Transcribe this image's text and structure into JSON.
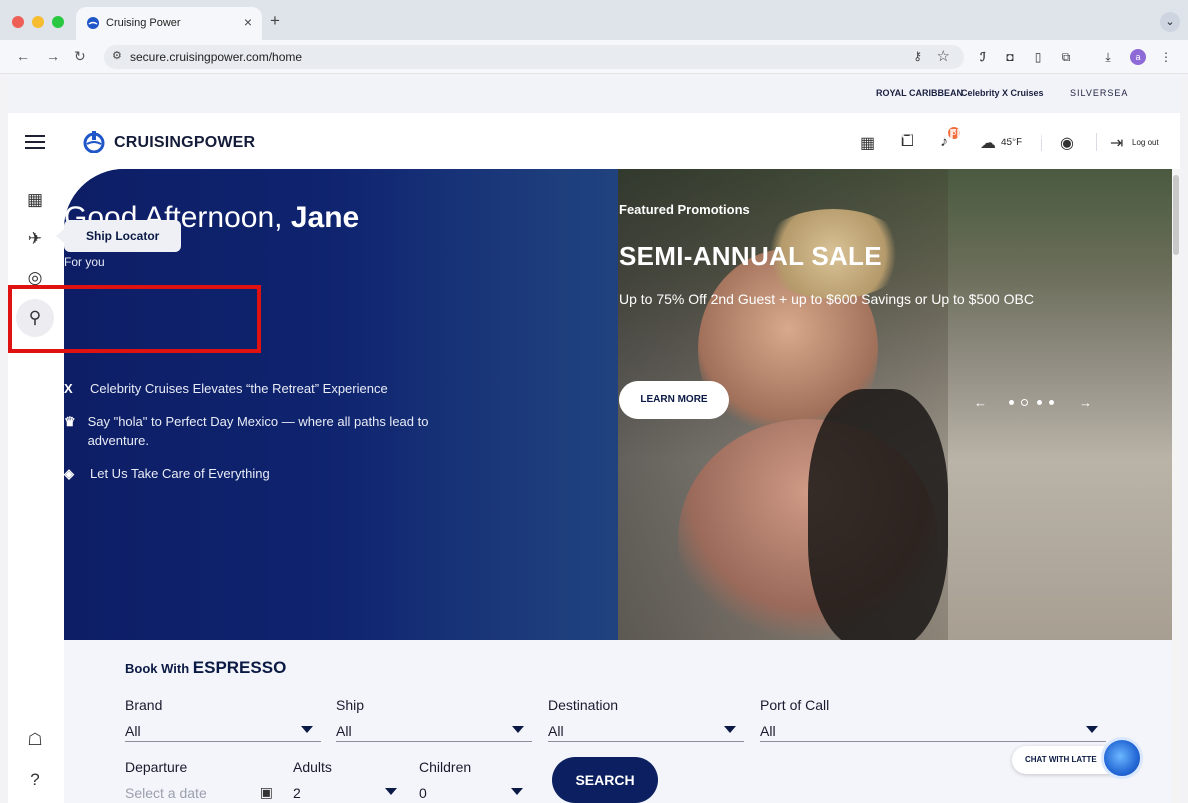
{
  "browser": {
    "tab_title": "Cruising Power",
    "url": "secure.cruisingpower.com/home",
    "profile_initial": "a"
  },
  "brand_strip": {
    "royal": "ROYAL CARIBBEAN",
    "celebrity": "Celebrity X Cruises",
    "silversea": "SILVERSEA"
  },
  "header": {
    "logo_text": "CRUISINGPOWER",
    "notification_count": "3",
    "weather": "45°F",
    "logout_label": "Log out"
  },
  "sidebar": {
    "tooltip": "Ship Locator",
    "items": [
      {
        "name": "calendar-plus-icon",
        "glyph": "▦"
      },
      {
        "name": "airplane-icon",
        "glyph": "✈"
      },
      {
        "name": "cruise-icon",
        "glyph": "◎"
      },
      {
        "name": "ship-locator-icon",
        "glyph": "⚲"
      },
      {
        "name": "chat-support-icon",
        "glyph": "☖"
      },
      {
        "name": "help-icon",
        "glyph": "?"
      }
    ]
  },
  "hero": {
    "greeting_prefix": "Good Afternoon, ",
    "greeting_name": "Jane",
    "for_you": "For you",
    "news": [
      {
        "icon": "X",
        "text": "Celebrity Cruises Elevates “the Retreat” Experience"
      },
      {
        "icon": "♛",
        "text": "Say \"hola\" to Perfect Day Mexico — where all paths lead to adventure."
      },
      {
        "icon": "◈",
        "text": "Let Us Take Care of Everything"
      }
    ],
    "promo_kicker": "Featured Promotions",
    "promo_title": "SEMI-ANNUAL SALE",
    "promo_desc": "Up to 75% Off 2nd Guest + up to $600 Savings or Up to $500 OBC",
    "learn_more": "LEARN MORE",
    "promo_brand": "Celebrity X Cruises",
    "carousel_active_index": 1,
    "carousel_count": 4
  },
  "booking": {
    "title_prefix": "Book With ",
    "title_brand": "ESPRESSO",
    "fields": {
      "brand": {
        "label": "Brand",
        "value": "All"
      },
      "ship": {
        "label": "Ship",
        "value": "All"
      },
      "destination": {
        "label": "Destination",
        "value": "All"
      },
      "port": {
        "label": "Port of Call",
        "value": "All"
      },
      "departure": {
        "label": "Departure",
        "placeholder": "Select a date"
      },
      "adults": {
        "label": "Adults",
        "value": "2"
      },
      "children": {
        "label": "Children",
        "value": "0"
      }
    },
    "search_label": "SEARCH"
  },
  "chat": {
    "label": "CHAT WITH LATTE"
  },
  "colors": {
    "hero_blue": "#0f2266",
    "accent_navy": "#0c1f60",
    "highlight_red": "#e01111",
    "badge_orange": "#f26b3a"
  }
}
